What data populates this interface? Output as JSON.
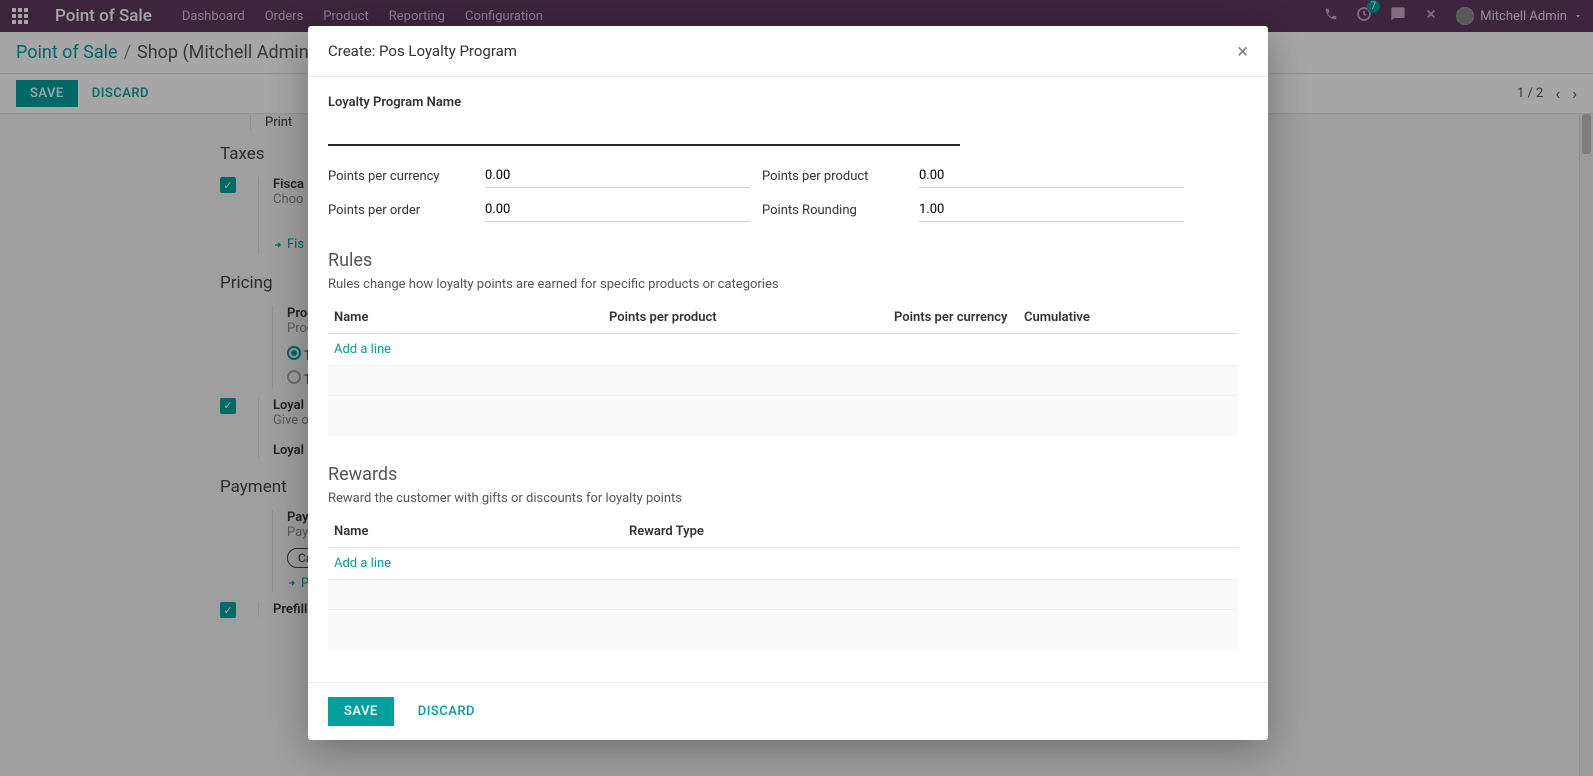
{
  "navbar": {
    "app_name": "Point of Sale",
    "items": [
      "Dashboard",
      "Orders",
      "Product",
      "Reporting",
      "Configuration"
    ],
    "notification_badge": "7",
    "user_name": "Mitchell Admin"
  },
  "breadcrumb": {
    "root": "Point of Sale",
    "current": "Shop (Mitchell Admin)"
  },
  "controls": {
    "save": "SAVE",
    "discard": "DISCARD",
    "pager": "1 / 2"
  },
  "bg": {
    "print": "Print",
    "taxes_title": "Taxes",
    "fiscal_label": "Fisca",
    "fiscal_sub": "Choo",
    "fiscal_link": "Fis",
    "pricing_title": "Pricing",
    "product_label": "Prod",
    "product_sub": "Prod",
    "tax_radio1": "Ta",
    "tax_radio2": "Ta",
    "loyal_label": "Loyal",
    "loyal_sub": "Give o",
    "loyal_field": "Loyal",
    "payment_title": "Payment",
    "payment_label": "Paym",
    "payment_sub": "Paym",
    "cash_tag": "Cash",
    "cash_link": "Pa",
    "prefill_label": "Prefill Cash Payment"
  },
  "modal": {
    "title": "Create: Pos Loyalty Program",
    "name_label": "Loyalty Program Name",
    "name_value": "",
    "fields": {
      "ppc_label": "Points per currency",
      "ppc_value": "0.00",
      "ppp_label": "Points per product",
      "ppp_value": "0.00",
      "ppo_label": "Points per order",
      "ppo_value": "0.00",
      "pr_label": "Points Rounding",
      "pr_value": "1.00"
    },
    "rules": {
      "title": "Rules",
      "desc": "Rules change how loyalty points are earned for specific products or categories",
      "headers": [
        "Name",
        "Points per product",
        "Points per currency",
        "Cumulative"
      ],
      "add_line": "Add a line"
    },
    "rewards": {
      "title": "Rewards",
      "desc": "Reward the customer with gifts or discounts for loyalty points",
      "headers": [
        "Name",
        "Reward Type"
      ],
      "add_line": "Add a line"
    },
    "footer": {
      "save": "SAVE",
      "discard": "DISCARD"
    }
  }
}
